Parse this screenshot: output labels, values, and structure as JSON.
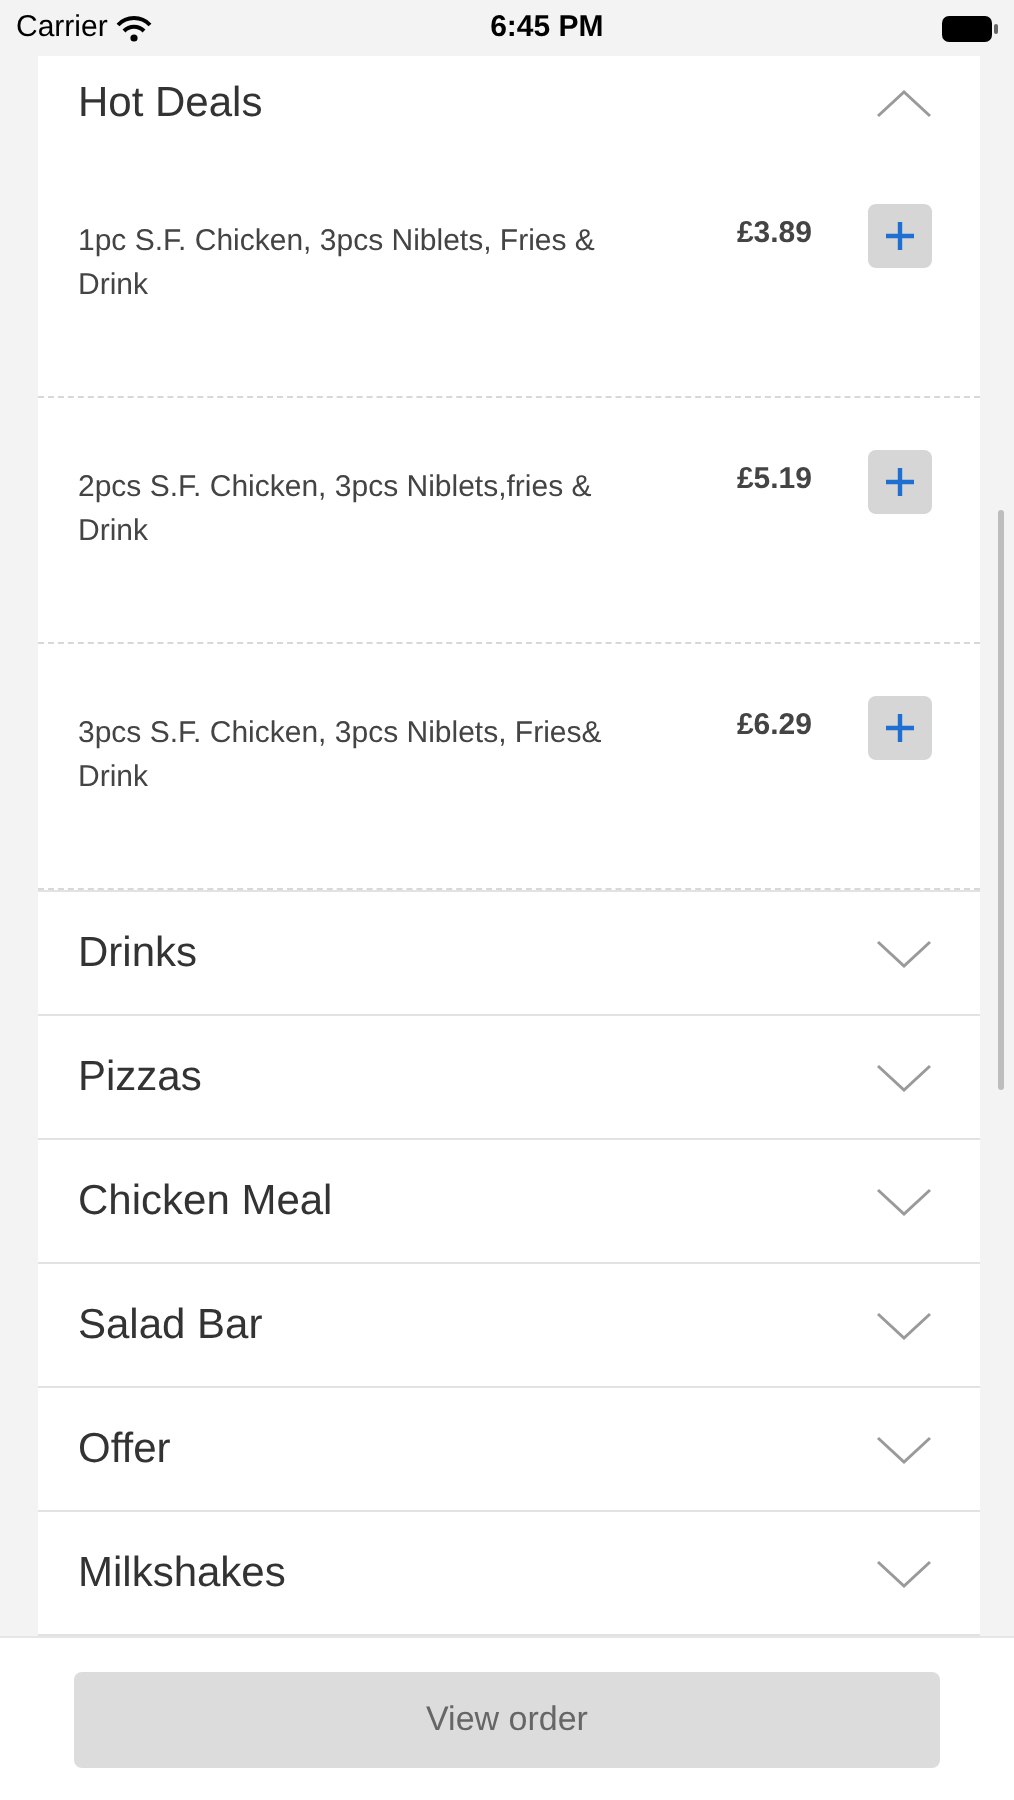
{
  "status_bar": {
    "carrier": "Carrier",
    "time": "6:45 PM"
  },
  "categories": [
    {
      "name": "Hot Deals",
      "expanded": true,
      "items": [
        {
          "name": "1pc S.F. Chicken, 3pcs Niblets, Fries & Drink",
          "price": "£3.89"
        },
        {
          "name": "2pcs S.F. Chicken, 3pcs Niblets,fries & Drink",
          "price": "£5.19"
        },
        {
          "name": "3pcs S.F. Chicken, 3pcs Niblets, Fries& Drink",
          "price": "£6.29"
        }
      ]
    },
    {
      "name": "Drinks",
      "expanded": false
    },
    {
      "name": "Pizzas",
      "expanded": false
    },
    {
      "name": "Chicken Meal",
      "expanded": false
    },
    {
      "name": "Salad Bar",
      "expanded": false
    },
    {
      "name": "Offer",
      "expanded": false
    },
    {
      "name": "Milkshakes",
      "expanded": false
    }
  ],
  "footer": {
    "button": "View order"
  }
}
